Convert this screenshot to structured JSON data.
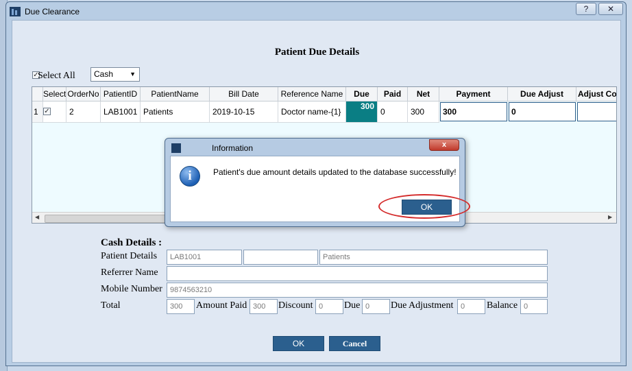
{
  "window": {
    "title": "Due Clearance",
    "help_label": "?",
    "close_label": "✕"
  },
  "page": {
    "heading": "Patient Due Details",
    "select_all": {
      "label": "Select All",
      "checked": true
    },
    "payment_mode": "Cash"
  },
  "grid": {
    "headers": [
      "Select",
      "OrderNo",
      "PatientID",
      "PatientName",
      "Bill Date",
      "Reference Name",
      "Due",
      "Paid",
      "Net",
      "Payment",
      "Due Adjust",
      "Adjust Con"
    ],
    "rows": [
      {
        "index": "1",
        "select": true,
        "order_no": "2",
        "patient_id": "LAB1001",
        "patient_name": "Patients",
        "bill_date": "2019-10-15",
        "reference_name": "Doctor name-{1}",
        "due": "300",
        "paid": "0",
        "net": "300",
        "payment": "300",
        "due_adjust": "0",
        "adjust_con": ""
      }
    ]
  },
  "cash_details": {
    "title": "Cash Details :",
    "patient_details_label": "Patient Details",
    "patient_id": "LAB1001",
    "patient_extra": "",
    "patient_name": "Patients",
    "referrer_label": "Referrer Name",
    "referrer_value": "",
    "mobile_label": "Mobile Number",
    "mobile_value": "9874563210",
    "total_label": "Total",
    "total_value": "300",
    "amount_paid_label": "Amount Paid",
    "amount_paid_value": "300",
    "discount_label": "Discount",
    "discount_value": "0",
    "due_label": "Due",
    "due_value": "0",
    "due_adjustment_label": "Due Adjustment",
    "due_adjustment_value": "0",
    "balance_label": "Balance",
    "balance_value": "0"
  },
  "actions": {
    "ok": "OK",
    "cancel": "Cancel"
  },
  "dialog": {
    "title": "Information",
    "close_label": "x",
    "message": "Patient's due amount details updated to the database successfully!",
    "ok": "OK",
    "icon": "info-icon"
  },
  "colors": {
    "highlight": "#d42a2a",
    "accent": "#2b5f8e",
    "due_cell": "#0a7e84"
  }
}
